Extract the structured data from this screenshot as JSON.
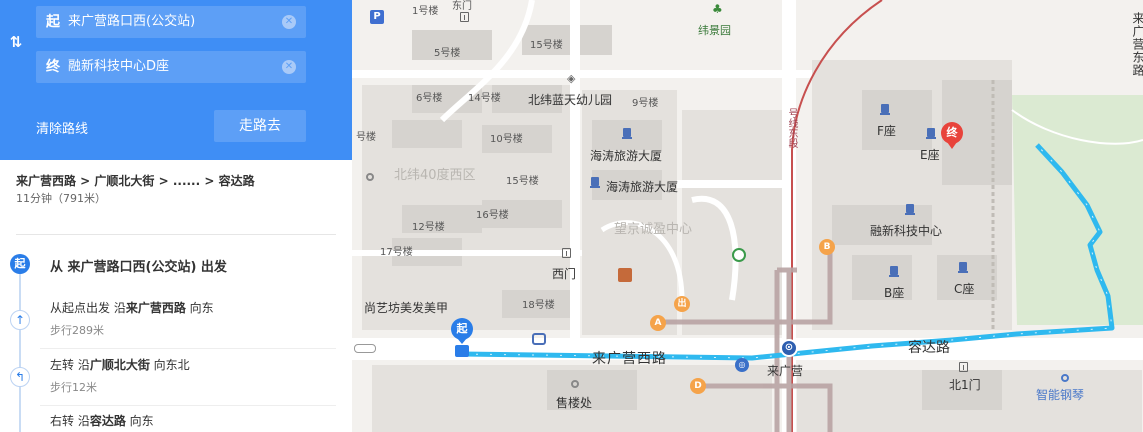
{
  "route_panel": {
    "start_prefix": "起",
    "start_value": "来广营路口西(公交站)",
    "end_prefix": "终",
    "end_value": "融新科技中心D座",
    "clear_label": "清除路线",
    "walk_label": "走路去",
    "swap_icon": "swap-arrows-icon"
  },
  "summary": {
    "path": "来广营西路 > 广顺北大街 > ...... > 容达路",
    "time": "11分钟（791米）"
  },
  "steps": {
    "start_marker": "起",
    "depart_text": "从 来广营路口西(公交站) 出发",
    "step1": {
      "prefix": "从起点出发 沿",
      "road": "来广营西路",
      "suffix": " 向东",
      "sub": "步行289米",
      "icon": "arrow-up-icon"
    },
    "step2": {
      "prefix": "左转 沿",
      "road": "广顺北大街",
      "suffix": " 向东北",
      "sub": "步行12米",
      "icon": "turn-left-icon"
    },
    "step3": {
      "prefix": "右转 沿",
      "road": "容达路",
      "suffix": " 向东"
    }
  },
  "map": {
    "colors": {
      "route": "#2fb9ef",
      "subway": "#b9a4a4",
      "park": "#dbead2",
      "start_pin": "#2a7de8",
      "end_pin": "#e8433b"
    },
    "labels": {
      "b1": "1号楼",
      "east_gate": "东门",
      "weijingyuan": "纬景园",
      "b5": "5号楼",
      "b15a": "15号楼",
      "kindergarten": "北纬蓝天幼儿园",
      "b6": "6号楼",
      "b14": "14号楼",
      "b9": "9号楼",
      "b_partial": "号楼",
      "b10": "10号楼",
      "haitao1": "海涛旅游大厦",
      "haitao2": "海涛旅游大厦",
      "beiwei": "北纬40度西区",
      "b15b": "15号楼",
      "b16": "16号楼",
      "wangjing": "望京诚盈中心",
      "b12": "12号楼",
      "b17": "17号楼",
      "west_gate": "西门",
      "b18": "18号楼",
      "shangyi": "尚艺坊美发美甲",
      "laiguangying_west_rd": "来广营西路",
      "laiguangying": "来广营",
      "rongda_rd": "容达路",
      "north_gate": "北1门",
      "piano": "智能钢琴",
      "sales": "售楼处",
      "f_block": "F座",
      "e_block": "E座",
      "rongxin": "融新科技中心",
      "b_block": "B座",
      "c_block": "C座",
      "east_road_vert": "来广营东路",
      "line_vert": "号线东段"
    },
    "start_pin": "起",
    "end_pin": "终",
    "badge_a": "A",
    "badge_b": "B",
    "badge_d": "D",
    "badge_exit": "出",
    "parking": "P"
  }
}
